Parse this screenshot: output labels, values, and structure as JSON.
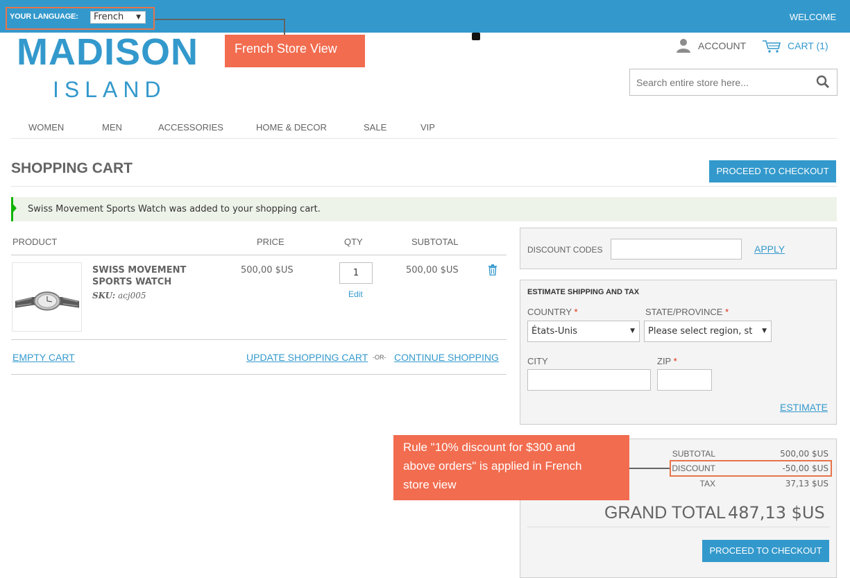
{
  "topbar": {
    "language_label": "YOUR LANGUAGE:",
    "language_value": "French",
    "welcome": "WELCOME",
    "color": "#3399cc"
  },
  "annotations": {
    "store_view_callout": "French Store View",
    "rule_callout_lines": [
      "Rule \"10% discount for $300 and",
      "above orders\" is applied in French",
      "store view"
    ],
    "callout_color": "#f26c4f"
  },
  "logo": {
    "main": "MADISON",
    "sub": "ISLAND"
  },
  "header": {
    "account": "ACCOUNT",
    "cart": "CART (1)",
    "search_placeholder": "Search entire store here..."
  },
  "nav": {
    "items": [
      "WOMEN",
      "MEN",
      "ACCESSORIES",
      "HOME & DECOR",
      "SALE",
      "VIP"
    ]
  },
  "page": {
    "title": "SHOPPING CART",
    "checkout_button": "PROCEED TO CHECKOUT",
    "success_message": "Swiss Movement Sports Watch was added to your shopping cart."
  },
  "cart_table": {
    "headers": {
      "product": "PRODUCT",
      "price": "PRICE",
      "qty": "QTY",
      "subtotal": "SUBTOTAL"
    },
    "items": [
      {
        "name": "SWISS MOVEMENT SPORTS WATCH",
        "sku_label": "SKU:",
        "sku": "acj005",
        "price": "500,00 $US",
        "qty": "1",
        "edit": "Edit",
        "subtotal": "500,00 $US"
      }
    ],
    "actions": {
      "empty": "EMPTY CART",
      "update": "UPDATE SHOPPING CART",
      "or": "-OR-",
      "continue": "CONTINUE SHOPPING"
    }
  },
  "discount": {
    "label": "DISCOUNT CODES",
    "apply": "APPLY"
  },
  "shipping": {
    "title": "ESTIMATE SHIPPING AND TAX",
    "country_label": "COUNTRY",
    "country_value": "États-Unis",
    "state_label": "STATE/PROVINCE",
    "state_value": "Please select region, st",
    "city_label": "CITY",
    "zip_label": "ZIP",
    "required_mark": "*",
    "estimate": "ESTIMATE"
  },
  "totals": {
    "subtotal_label": "SUBTOTAL",
    "subtotal_value": "500,00 $US",
    "discount_label": "DISCOUNT",
    "discount_value": "-50,00 $US",
    "tax_label": "TAX",
    "tax_value": "37,13 $US",
    "grand_label": "GRAND TOTAL",
    "grand_value": "487,13 $US",
    "checkout_button": "PROCEED TO CHECKOUT"
  }
}
